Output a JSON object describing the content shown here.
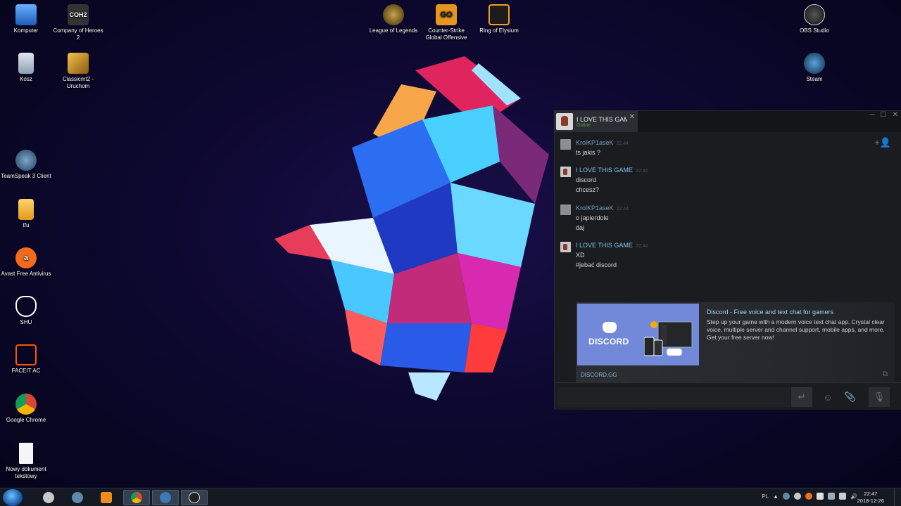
{
  "desktop": {
    "icons": [
      {
        "label": "Komputer",
        "icon": "computer-icon"
      },
      {
        "label": "Company of Heroes 2",
        "icon": "coh2-icon",
        "glyph": "COH2"
      },
      {
        "label": "Kosz",
        "icon": "recycle-bin-icon"
      },
      {
        "label": "Classicmt2 - Uruchom",
        "icon": "metin2-icon"
      },
      {
        "label": "TeamSpeak 3 Client",
        "icon": "teamspeak-icon"
      },
      {
        "label": "tfu",
        "icon": "folder-icon"
      },
      {
        "label": "Avast Free Antivirus",
        "icon": "avast-icon"
      },
      {
        "label": "SHU",
        "icon": "cat-mask-icon"
      },
      {
        "label": "FACEIT AC",
        "icon": "faceit-icon"
      },
      {
        "label": "Google Chrome",
        "icon": "chrome-icon"
      },
      {
        "label": "Nowy dokument tekstowy",
        "icon": "text-document-icon"
      },
      {
        "label": "League of Legends",
        "icon": "lol-icon"
      },
      {
        "label": "Counter-Strike Global Offensive",
        "icon": "csgo-icon",
        "glyph": "GO"
      },
      {
        "label": "Ring of Elysium",
        "icon": "roe-icon"
      },
      {
        "label": "OBS Studio",
        "icon": "obs-icon"
      },
      {
        "label": "Steam",
        "icon": "steam-icon"
      }
    ]
  },
  "chat": {
    "tab": {
      "name": "I LOVE THIS GAM",
      "status": "Online",
      "close": "✕"
    },
    "window_controls": [
      "─",
      "☐",
      "✕"
    ],
    "add_friend_icon": "+👤",
    "messages": [
      {
        "author": "KrolKP1aseK",
        "time": "22:44",
        "lines": [
          "ts jakis ?"
        ]
      },
      {
        "author": "I LOVE THIS GAME",
        "time": "22:44",
        "lines": [
          "discord",
          "chcesz?"
        ]
      },
      {
        "author": "KrolKP1aseK",
        "time": "22:44",
        "lines": [
          "o japierdole",
          "daj"
        ]
      },
      {
        "author": "I LOVE THIS GAME",
        "time": "22:44",
        "lines": [
          "XD",
          "#jebać discord"
        ]
      }
    ],
    "embed": {
      "logo_text": "DISCORD",
      "title": "Discord - Free voice and text chat for gamers",
      "description": "Step up your game with a modern voice text chat app. Crystal clear voice, multiple server and channel support, mobile apps, and more. Get your free server now!",
      "domain": "DISCORD.GG"
    },
    "input": {
      "placeholder": "",
      "send": "↵",
      "emoji": "☺",
      "attach": "📎",
      "voice": "🎙"
    }
  },
  "taskbar": {
    "apps": [
      "explorer",
      "skype",
      "teamspeak",
      "media",
      "chrome",
      "steam",
      "obs"
    ],
    "tray": {
      "lang": "PL"
    },
    "clock": {
      "time": "22:47",
      "date": "2018-12-26"
    }
  },
  "colors": {
    "accent_blue": "#7289da",
    "steam_bg": "#1b1c1f",
    "online": "#5a9e4a"
  }
}
